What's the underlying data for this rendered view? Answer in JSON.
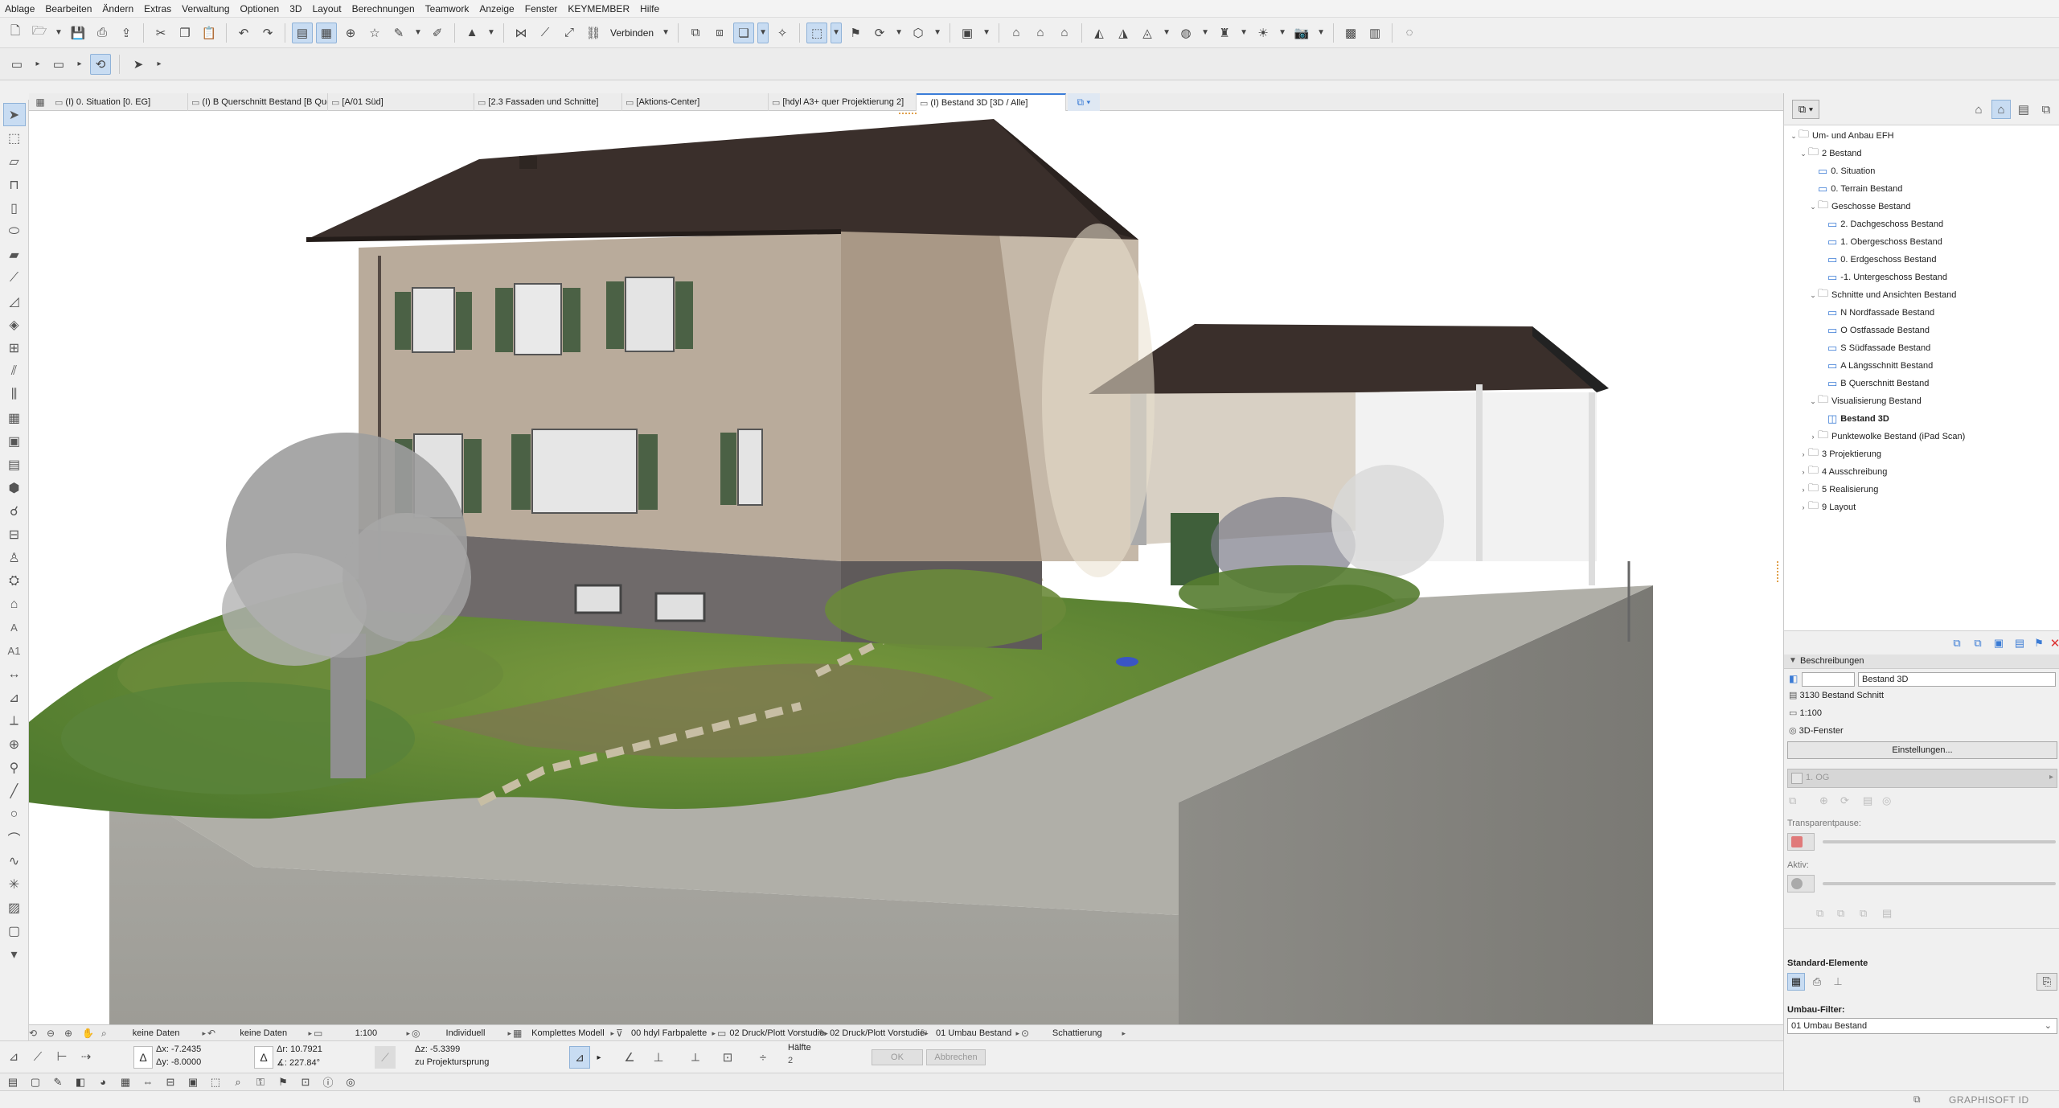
{
  "menu": [
    "Ablage",
    "Bearbeiten",
    "Ändern",
    "Extras",
    "Verwaltung",
    "Optionen",
    "3D",
    "Layout",
    "Berechnungen",
    "Teamwork",
    "Anzeige",
    "Fenster",
    "KEYMEMBER",
    "Hilfe"
  ],
  "toolbar": {
    "connect_label": "Verbinden"
  },
  "tabs": [
    {
      "label": "(I) 0. Situation [0. EG]",
      "active": false
    },
    {
      "label": "(I) B Querschnitt Bestand [B Querschnitt Bestand]",
      "active": false
    },
    {
      "label": "[A/01 Süd]",
      "active": false
    },
    {
      "label": "[2.3 Fassaden und Schnitte]",
      "active": false
    },
    {
      "label": "[Aktions-Center]",
      "active": false
    },
    {
      "label": "[hdyl A3+ quer Projektierung 2]",
      "active": false
    },
    {
      "label": "(I) Bestand 3D [3D / Alle]",
      "active": true
    }
  ],
  "toolbox": {
    "label_a": "A",
    "label_a1": "A1"
  },
  "statusbar": {
    "no_data_1": "keine Daten",
    "no_data_2": "keine Daten",
    "scale": "1:100",
    "layer": "Individuell",
    "model": "Komplettes Modell",
    "palette": "00 hdyl Farbpalette",
    "print1": "02 Druck/Plott Vorstudie",
    "print2": "02 Druck/Plott Vorstudie",
    "renovation": "01 Umbau Bestand",
    "shading": "Schattierung"
  },
  "coords": {
    "dx": "-7.2435",
    "dy": "-8.0000",
    "ox": "10.7921",
    "angle": "227.84°",
    "dz": "-5.3399",
    "zref": "zu Projektursprung",
    "half_label": "Hälfte",
    "half_value": "2",
    "ok": "OK",
    "cancel": "Abbrechen"
  },
  "navigator": {
    "root": "Um- und Anbau EFH",
    "items": [
      {
        "label": "2 Bestand",
        "level": 1,
        "open": true,
        "kind": "folder"
      },
      {
        "label": "0. Situation",
        "level": 2,
        "kind": "view"
      },
      {
        "label": "0. Terrain Bestand",
        "level": 2,
        "kind": "view"
      },
      {
        "label": "Geschosse Bestand",
        "level": 2,
        "open": true,
        "kind": "folder"
      },
      {
        "label": "2. Dachgeschoss Bestand",
        "level": 3,
        "kind": "view"
      },
      {
        "label": "1. Obergeschoss Bestand",
        "level": 3,
        "kind": "view"
      },
      {
        "label": "0. Erdgeschoss Bestand",
        "level": 3,
        "kind": "view"
      },
      {
        "label": "-1. Untergeschoss Bestand",
        "level": 3,
        "kind": "view"
      },
      {
        "label": "Schnitte und Ansichten Bestand",
        "level": 2,
        "open": true,
        "kind": "folder"
      },
      {
        "label": "N Nordfassade Bestand",
        "level": 3,
        "kind": "view"
      },
      {
        "label": "O Ostfassade Bestand",
        "level": 3,
        "kind": "view"
      },
      {
        "label": "S Südfassade Bestand",
        "level": 3,
        "kind": "view"
      },
      {
        "label": "A Längsschnitt Bestand",
        "level": 3,
        "kind": "view"
      },
      {
        "label": "B Querschnitt Bestand",
        "level": 3,
        "kind": "view"
      },
      {
        "label": "Visualisierung Bestand",
        "level": 2,
        "open": true,
        "kind": "folder"
      },
      {
        "label": "Bestand 3D",
        "level": 3,
        "kind": "view3d",
        "selected": true
      },
      {
        "label": "Punktewolke Bestand (iPad Scan)",
        "level": 2,
        "open": false,
        "kind": "folder"
      },
      {
        "label": "3 Projektierung",
        "level": 1,
        "open": false,
        "kind": "folder"
      },
      {
        "label": "4 Ausschreibung",
        "level": 1,
        "open": false,
        "kind": "folder"
      },
      {
        "label": "5 Realisierung",
        "level": 1,
        "open": false,
        "kind": "folder"
      },
      {
        "label": "9 Layout",
        "level": 1,
        "open": false,
        "kind": "folder"
      }
    ]
  },
  "properties": {
    "section": "Beschreibungen",
    "name": "Bestand 3D",
    "ref": "3130 Bestand Schnitt",
    "scale": "1:100",
    "window": "3D-Fenster",
    "settings_btn": "Einstellungen...",
    "floor": "1. OG",
    "transparent_label": "Transparentpause:",
    "active_label": "Aktiv:",
    "std_label": "Standard-Elemente",
    "filter_label": "Umbau-Filter:",
    "filter_value": "01 Umbau Bestand"
  },
  "footer": {
    "brand": "GRAPHISOFT ID"
  },
  "colors": {
    "accent": "#3b7dd8",
    "roof": "#3a2f2b",
    "wall": "#b7a898",
    "shutter": "#4b6145",
    "grass": "#5e8a35",
    "terrain": "#a3a29c"
  }
}
